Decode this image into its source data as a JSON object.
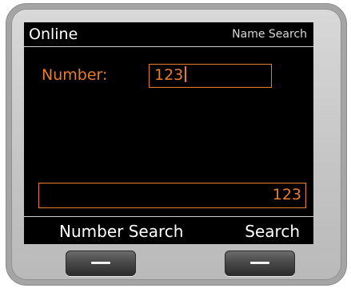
{
  "status_bar": {
    "title": "Online",
    "screen_name": "Name Search"
  },
  "form": {
    "label": "Number:",
    "value": "123"
  },
  "result": {
    "value": "123"
  },
  "softkeys": {
    "left_label": "Number Search",
    "right_label": "Search"
  },
  "colors": {
    "accent": "#e87d2a",
    "screen_bg": "#000000",
    "text": "#ffffff"
  }
}
